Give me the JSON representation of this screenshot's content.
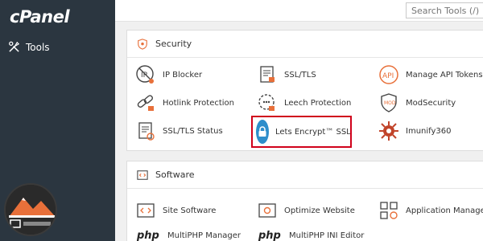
{
  "sidebar": {
    "logo_text": "cPanel",
    "nav_tools_label": "Tools"
  },
  "topbar": {
    "search_placeholder": "Search Tools (/)"
  },
  "security": {
    "title": "Security",
    "items": [
      {
        "label": "IP Blocker"
      },
      {
        "label": "SSL/TLS"
      },
      {
        "label": "Manage API Tokens"
      },
      {
        "label": "Hotlink Protection"
      },
      {
        "label": "Leech Protection"
      },
      {
        "label": "ModSecurity"
      },
      {
        "label": "SSL/TLS Status"
      },
      {
        "label": "Lets Encrypt™ SSL"
      },
      {
        "label": "Imunify360"
      }
    ]
  },
  "software": {
    "title": "Software",
    "items": [
      {
        "label": "Site Software"
      },
      {
        "label": "Optimize Website"
      },
      {
        "label": "Application Manager"
      },
      {
        "label": "MultiPHP Manager",
        "prefix": "php"
      },
      {
        "label": "MultiPHP INI Editor",
        "prefix": "php"
      }
    ]
  },
  "colors": {
    "sidebar_bg": "#2b3640",
    "highlight_border": "#d0021b",
    "lets_encrypt_blue": "#2e8ecb",
    "accent_orange": "#e8703a"
  }
}
